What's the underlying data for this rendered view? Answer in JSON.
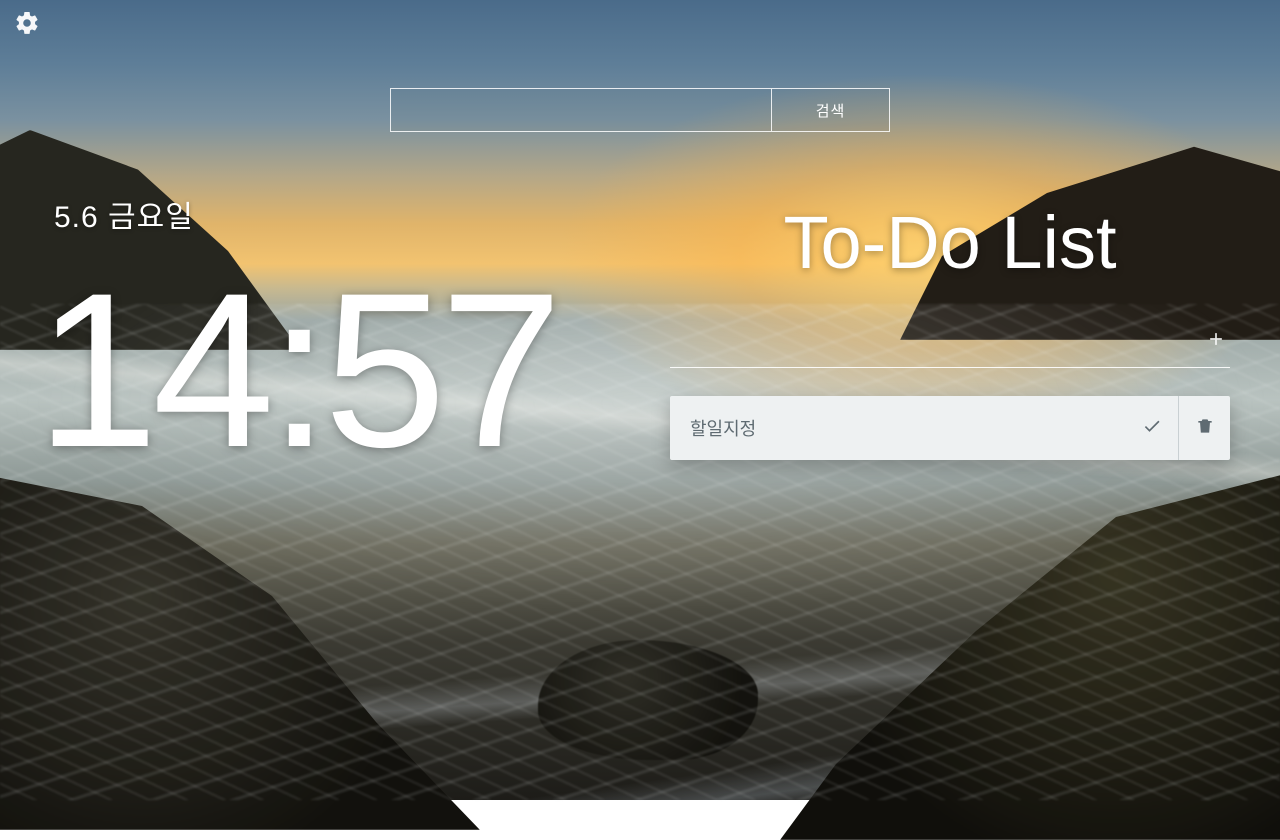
{
  "date_label": "5.6 금요일",
  "clock": "14:57",
  "search": {
    "value": "",
    "button_label": "검색"
  },
  "todo": {
    "title": "To-Do List",
    "new_item_value": "",
    "items": [
      {
        "text": "할일지정"
      }
    ]
  }
}
